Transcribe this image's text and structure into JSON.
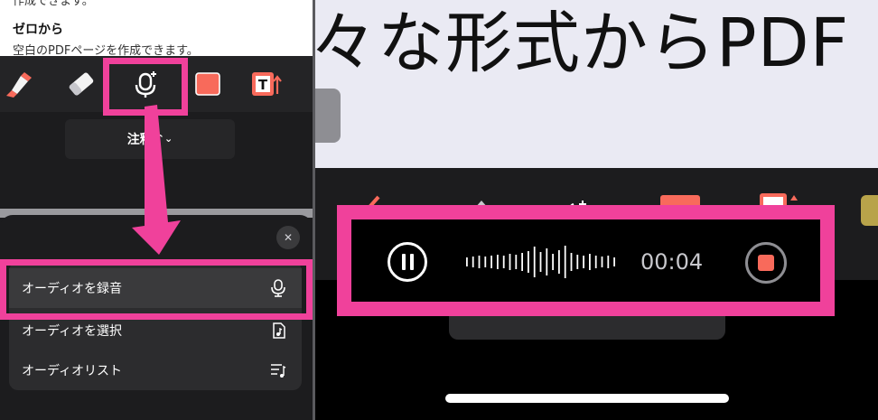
{
  "document": {
    "cut_text": "作成できます。",
    "heading": "ゼロから",
    "description": "空白のPDFページを作成できます。",
    "big_heading": "々な形式からPDF"
  },
  "toolbar": {
    "tools": [
      {
        "icon": "highlighter-icon"
      },
      {
        "icon": "eraser-icon"
      },
      {
        "icon": "microphone-icon",
        "selected": true
      },
      {
        "icon": "shape-icon"
      },
      {
        "icon": "text-box-icon"
      }
    ],
    "mode_label": "注釈",
    "mode_chevron": "⌃⌄"
  },
  "audio_menu": {
    "close_glyph": "✕",
    "items": [
      {
        "label": "オーディオを録音",
        "icon": "microphone-icon"
      },
      {
        "label": "オーディオを選択",
        "icon": "audio-file-icon"
      },
      {
        "label": "オーディオリスト",
        "icon": "music-list-icon"
      }
    ]
  },
  "recorder": {
    "time": "00:04"
  },
  "colors": {
    "highlight": "#f0419b",
    "accent_red": "#f86a5b",
    "panel_bg": "#1c1c1e",
    "page_bg": "#eaeaf3"
  }
}
